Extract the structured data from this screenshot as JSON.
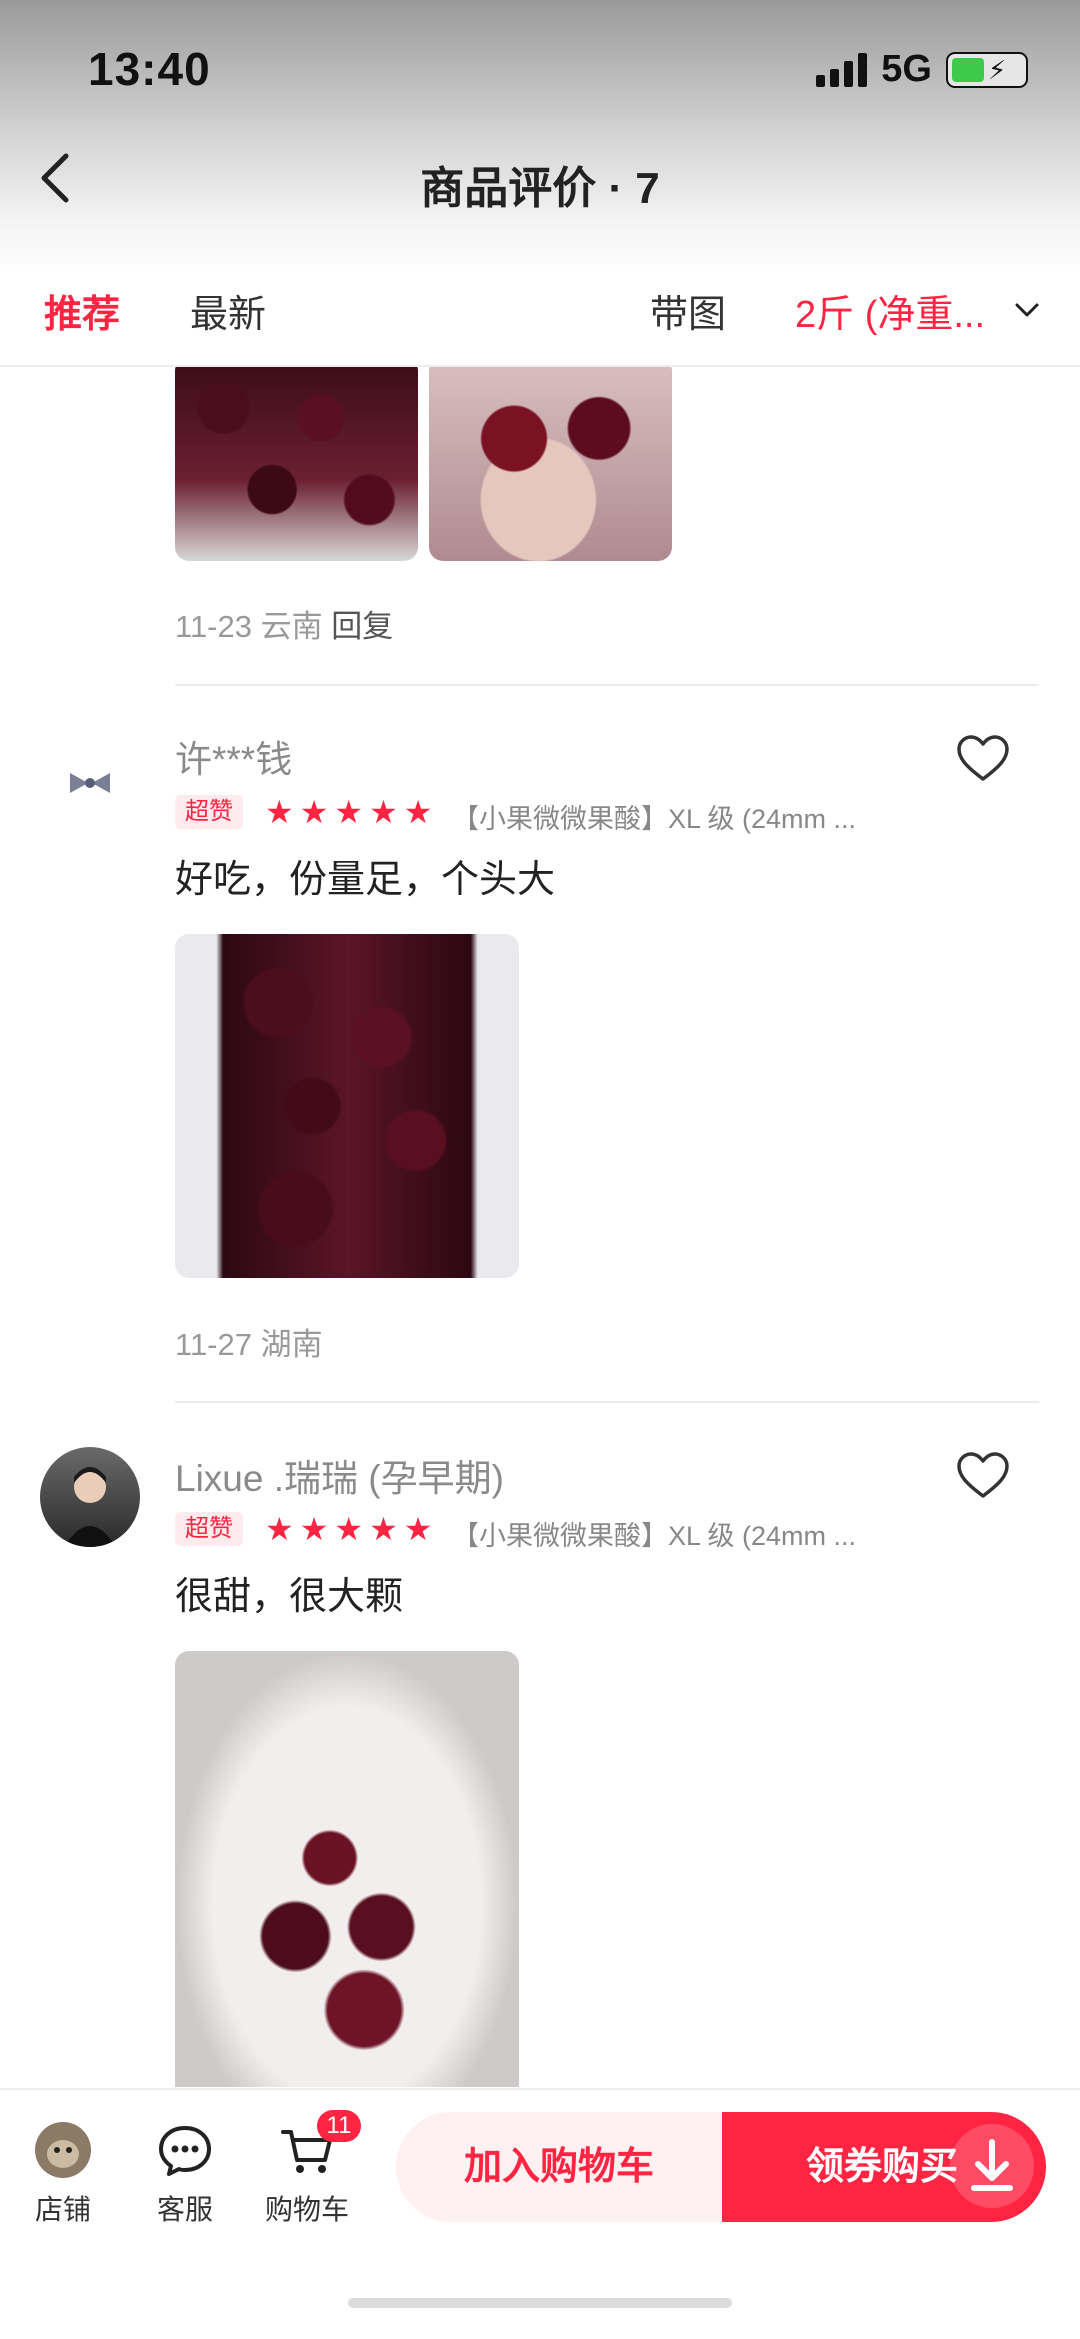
{
  "status_bar": {
    "time": "13:40",
    "network": "5G",
    "battery_level": 0.45
  },
  "header": {
    "title": "商品评价 · 7"
  },
  "tabs": [
    {
      "label": "推荐",
      "active": true
    },
    {
      "label": "最新",
      "active": false
    },
    {
      "label": "带图",
      "active": false
    },
    {
      "label": "2斤 (净重...",
      "active": false
    }
  ],
  "reviews": [
    {
      "date_region": "11-23 云南",
      "reply_label": "回复"
    },
    {
      "username": "许***钱",
      "badge": "超赞",
      "rating": 5,
      "spec": "【小果微微果酸】XL 级 (24mm ...",
      "text": "好吃，份量足，个头大",
      "date_region": "11-27 湖南"
    },
    {
      "username": "Lixue .瑞瑞 (孕早期)",
      "badge": "超赞",
      "rating": 5,
      "spec": "【小果微微果酸】XL 级 (24mm ...",
      "text": "很甜，很大颗"
    }
  ],
  "bottom_bar": {
    "store_label": "店铺",
    "service_label": "客服",
    "cart_label": "购物车",
    "cart_count": "11",
    "add_to_cart_label": "加入购物车",
    "buy_label": "领券购买"
  },
  "colors": {
    "accent": "#ff2442",
    "badge_bg": "#ffebee"
  }
}
